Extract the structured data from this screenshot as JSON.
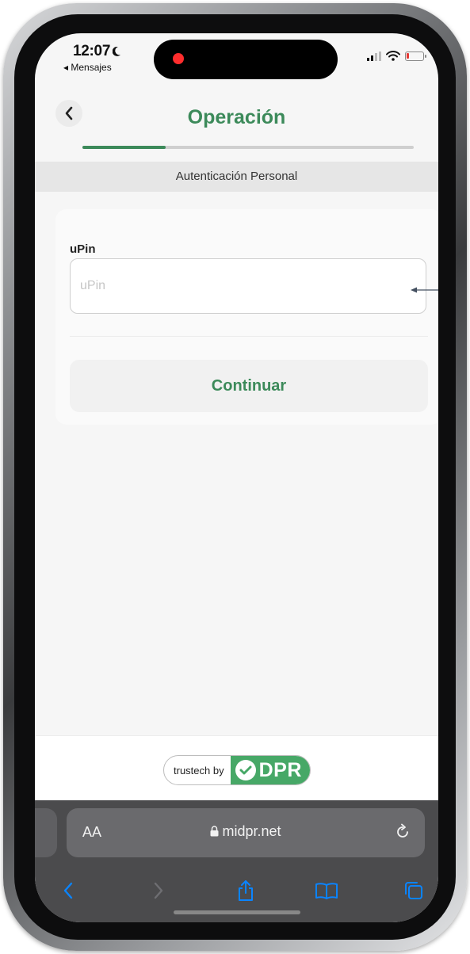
{
  "status_bar": {
    "time": "12:07",
    "back_app": "◂ Mensajes"
  },
  "header": {
    "title": "Operación",
    "progress_fraction": 0.25
  },
  "subheader": "Autenticación Personal",
  "form": {
    "upin_label": "uPin",
    "upin_placeholder": "uPin",
    "upin_value": "",
    "continue_label": "Continuar"
  },
  "footer": {
    "badge_prefix": "trustech by",
    "badge_brand": "DPR"
  },
  "browser": {
    "text_size_button": "AA",
    "url": "midpr.net"
  },
  "colors": {
    "accent_green": "#3c8a5a",
    "brand_green": "#47a867",
    "recording_red": "#ff2d2d",
    "ios_blue": "#0a84ff"
  },
  "icons": {
    "back": "chevron-left-icon",
    "moon": "moon-icon",
    "signal": "signal-icon",
    "wifi": "wifi-icon",
    "battery": "battery-icon",
    "lock": "lock-icon",
    "reload": "reload-icon",
    "share": "share-icon",
    "bookmarks": "bookmarks-icon",
    "tabs": "tabs-icon"
  }
}
